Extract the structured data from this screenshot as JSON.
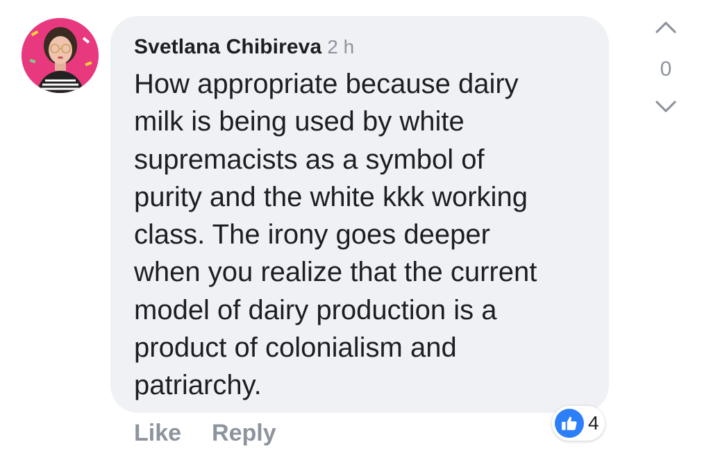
{
  "comment": {
    "author": "Svetlana Chibireva",
    "time": "2 h",
    "text": "How appropriate because dairy\nmilk is being used by white\nsupremacists as a symbol of\npurity and the white kkk working\nclass. The  irony goes deeper\nwhen you realize that the current\nmodel of dairy production is a\nproduct of colonialism and\npatriarchy."
  },
  "actions": {
    "like_label": "Like",
    "reply_label": "Reply"
  },
  "reactions": {
    "icon": "thumbs-up-icon",
    "count": "4",
    "color": "#2d7ff9"
  },
  "vote": {
    "count": "0",
    "up_icon": "chevron-up-icon",
    "down_icon": "chevron-down-icon"
  },
  "colors": {
    "bubble": "#f0f1f4",
    "text": "#1c1e21",
    "muted": "#8d949e",
    "avatar_bg": "#e8397f"
  }
}
